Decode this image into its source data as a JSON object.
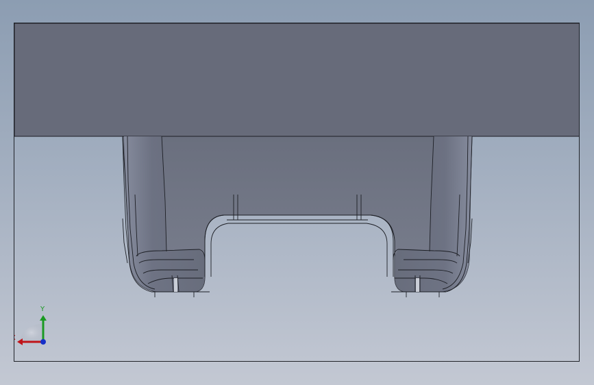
{
  "viewport": {
    "background_top": "#8c9db2",
    "background_bottom": "#c3c8d3",
    "model_face_color": "#666b7a",
    "model_edge_color": "#1c1e24"
  },
  "triad": {
    "x_label": "X",
    "y_label": "Y",
    "x_color": "#c0141a",
    "y_color": "#1a9a22",
    "z_color": "#1530c8"
  }
}
